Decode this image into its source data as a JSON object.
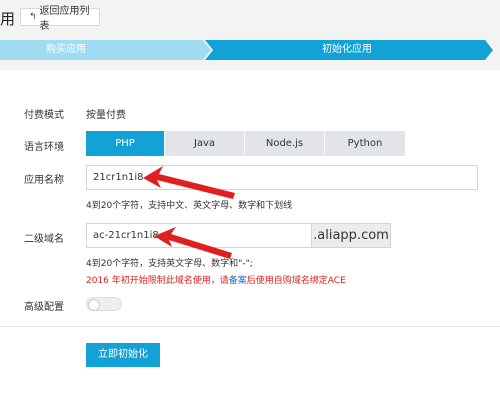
{
  "header": {
    "title_fragment": "用",
    "back_icon": "back-arrow-icon",
    "back_label": "返回应用列表"
  },
  "steps": [
    {
      "label": "购买应用",
      "state": "completed"
    },
    {
      "label": "初始化应用",
      "state": "active"
    }
  ],
  "colors": {
    "accent": "#12a2d8",
    "completed_step": "#9fdcf1",
    "error": "#e02020",
    "annotation": "#e02020"
  },
  "form": {
    "billing": {
      "label": "付费模式",
      "value": "按量付费"
    },
    "language": {
      "label": "语言环境",
      "options": [
        "PHP",
        "Java",
        "Node.js",
        "Python"
      ],
      "selected": "PHP"
    },
    "app_name": {
      "label": "应用名称",
      "value": "21cr1n1i8",
      "hint": "4到20个字符，支持中文、英文字母、数字和下划线"
    },
    "domain": {
      "label": "二级域名",
      "value": "ac-21cr1n1i8",
      "suffix": ".aliapp.com",
      "hint": "4到20个字符，支持英文字母、数字和\"-\";",
      "warning_pre": "2016 年初开始限制此域名使用，请",
      "warning_link": "备案",
      "warning_post": "后使用自购域名绑定ACE"
    },
    "advanced": {
      "label": "高级配置",
      "enabled": false
    }
  },
  "submit_label": "立即初始化"
}
